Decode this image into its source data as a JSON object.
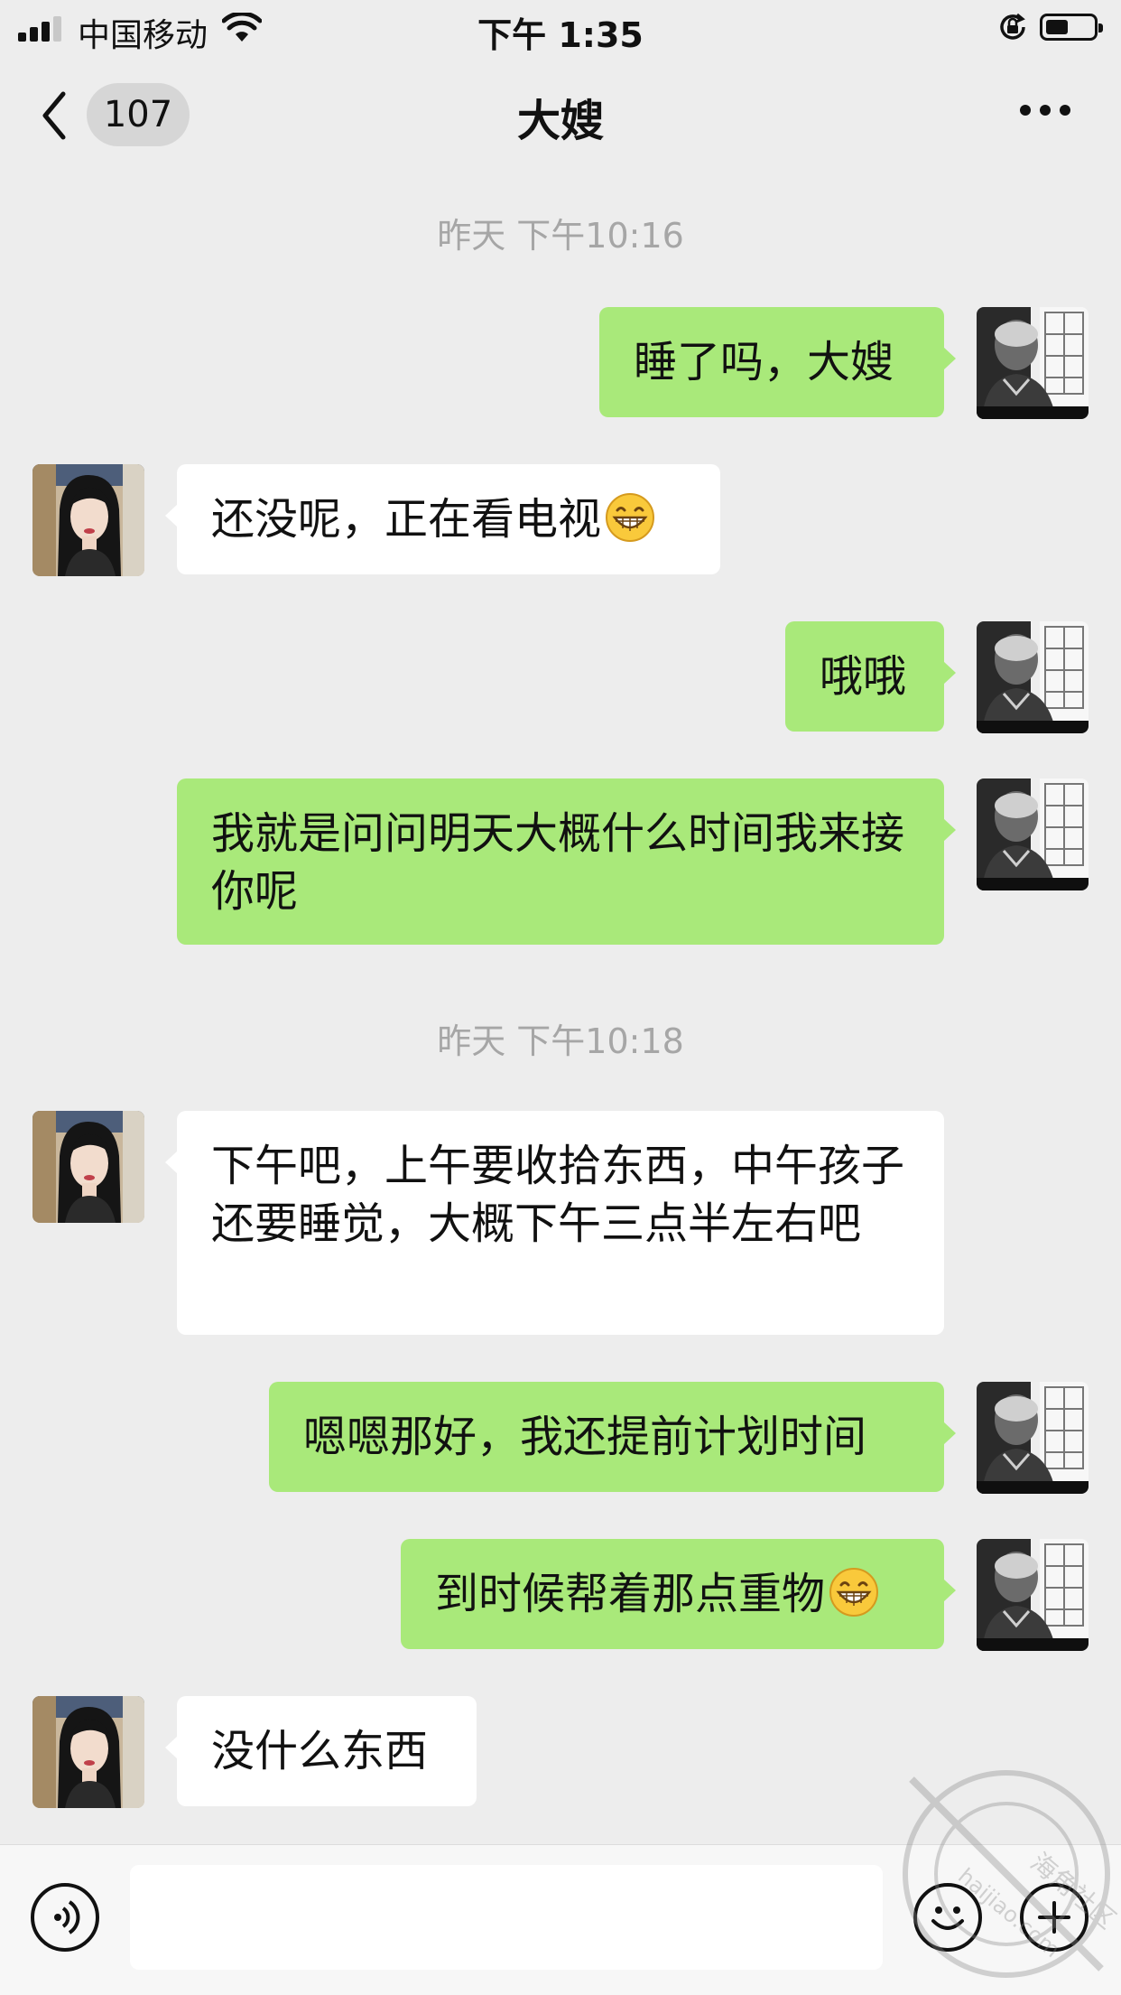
{
  "status_bar": {
    "carrier": "中国移动",
    "time": "下午 1:35"
  },
  "nav": {
    "unread_count": "107",
    "title": "大嫂"
  },
  "timestamps": [
    "昨天 下午10:16",
    "昨天 下午10:18"
  ],
  "messages": [
    {
      "side": "out",
      "text": "睡了吗，大嫂"
    },
    {
      "side": "in",
      "text": "还没呢，正在看电视",
      "emoji": "grinning-face"
    },
    {
      "side": "out",
      "text": "哦哦"
    },
    {
      "side": "out",
      "text": "我就是问问明天大概什么时间我来接你呢"
    },
    {
      "side": "in",
      "text": "下午吧，上午要收拾东西，中午孩子还要睡觉，大概下午三点半左右吧"
    },
    {
      "side": "out",
      "text": "嗯嗯那好，我还提前计划时间"
    },
    {
      "side": "out",
      "text": "到时候帮着那点重物",
      "emoji": "grinning-face"
    },
    {
      "side": "in",
      "text": "没什么东西"
    }
  ],
  "watermark": {
    "text": "海角社区",
    "url": "haijiao.com"
  },
  "colors": {
    "background": "#ededed",
    "outgoing_bubble": "#a9e97a",
    "incoming_bubble": "#ffffff",
    "timestamp": "#a6a6a6"
  },
  "icons": [
    "signal-icon",
    "wifi-icon",
    "rotation-lock-icon",
    "battery-icon",
    "back-chevron-icon",
    "more-icon",
    "voice-icon",
    "emoji-icon",
    "plus-icon"
  ]
}
